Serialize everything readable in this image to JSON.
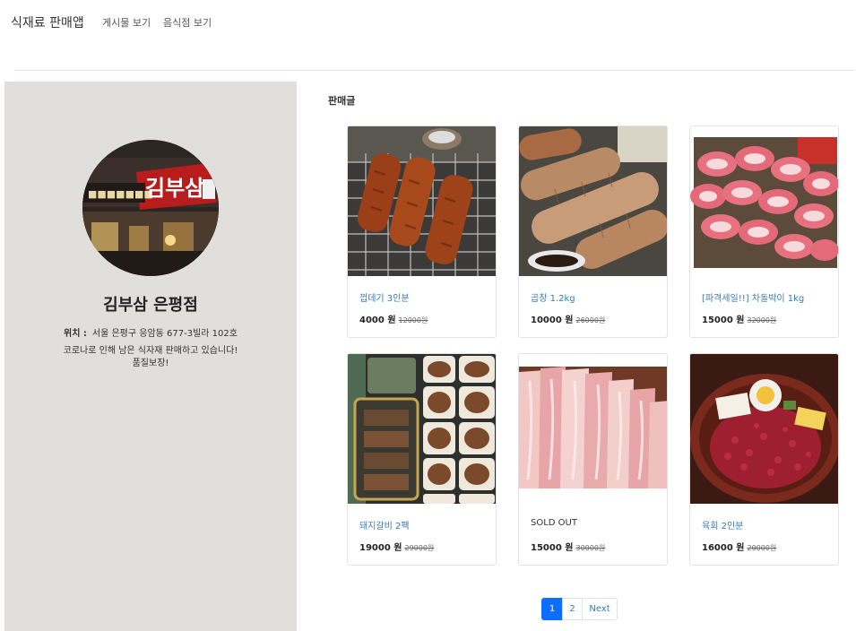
{
  "nav": {
    "brand": "식재료 판매앱",
    "links": [
      "게시물 보기",
      "음식점 보기"
    ]
  },
  "store": {
    "sign_text": "김부삼",
    "name": "김부삼 은평점",
    "location_label": "위치 :",
    "location_value": "서울 은평구 응암동 677-3빌라 102호",
    "desc_line1": "코로나로 인해 남은 식자재 판매하고 있습니다!",
    "desc_line2": "품질보장!"
  },
  "section_title": "판매글",
  "products": [
    {
      "title": "껍데기 3인분",
      "price": "4000 원",
      "original": "12000원",
      "image": "grilled-pork-skin-photo",
      "sold_out": false
    },
    {
      "title": "곱창 1.2kg",
      "price": "10000 원",
      "original": "26000원",
      "image": "grilled-gopchang-photo",
      "sold_out": false
    },
    {
      "title": "[파격세일!!] 차돌박이 1kg",
      "price": "15000 원",
      "original": "32000원",
      "image": "beef-brisket-rolls-photo",
      "sold_out": false
    },
    {
      "title": "돼지갈비 2팩",
      "price": "19000 원",
      "original": "29000원",
      "image": "pork-ribs-packs-photo",
      "sold_out": false
    },
    {
      "title": "SOLD OUT",
      "price": "15000 원",
      "original": "30000원",
      "image": "pork-belly-slices-photo",
      "sold_out": true
    },
    {
      "title": "육회 2인분",
      "price": "16000 원",
      "original": "20000원",
      "image": "yukhoe-platter-photo",
      "sold_out": false
    }
  ],
  "pagination": {
    "pages": [
      "1",
      "2"
    ],
    "active": "1",
    "next": "Next"
  },
  "colors": {
    "sidebar_bg": "#e1dfdc",
    "link": "#3a7ab8",
    "active_page": "#0d6efd"
  }
}
